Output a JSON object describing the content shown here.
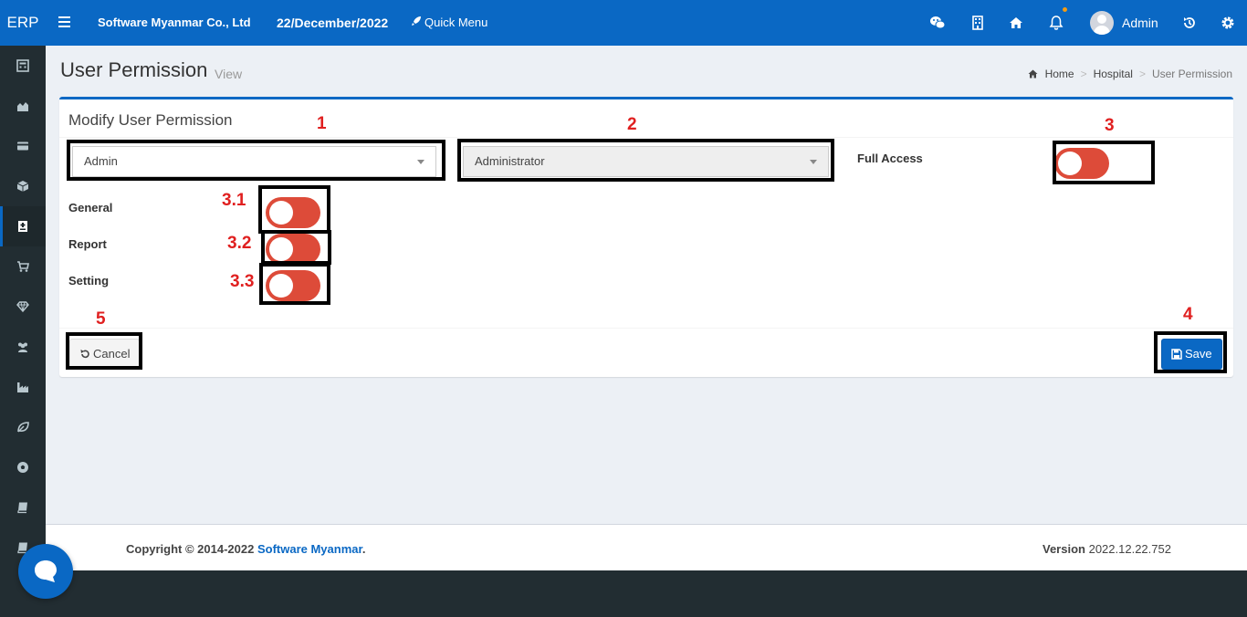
{
  "topbar": {
    "logo": "ERP",
    "company": "Software Myanmar Co., Ltd",
    "date": "22/December/2022",
    "quick_menu": "Quick Menu",
    "username": "Admin"
  },
  "sidebar": {
    "icons": [
      "calculator-icon",
      "area-chart-icon",
      "credit-card-icon",
      "cube-icon",
      "hospital-icon",
      "cart-icon",
      "diamond-icon",
      "users-icon",
      "industry-icon",
      "leaf-icon",
      "soccer-icon",
      "book-icon",
      "book-icon",
      "comment-icon"
    ],
    "active_index": 4
  },
  "header": {
    "title": "User Permission",
    "subtitle": "View",
    "breadcrumb": [
      "Home",
      "Hospital",
      "User Permission"
    ]
  },
  "box": {
    "title": "Modify User Permission",
    "user_select": "Admin",
    "role_select": "Administrator",
    "full_access_label": "Full Access",
    "permissions": [
      {
        "label": "General"
      },
      {
        "label": "Report"
      },
      {
        "label": "Setting"
      }
    ],
    "cancel_label": "Cancel",
    "save_label": "Save"
  },
  "annotations": [
    "1",
    "2",
    "3",
    "3.1",
    "3.2",
    "3.3",
    "4",
    "5"
  ],
  "footer": {
    "copyright_prefix": "Copyright © 2014-2022 ",
    "copyright_link": "Software Myanmar",
    "copyright_suffix": ".",
    "version_label": "Version",
    "version_value": "2022.12.22.752"
  },
  "colors": {
    "primary": "#0a68c4",
    "toggle_off": "#dd4b39",
    "sidebar": "#222d32",
    "annotation": "#e02020"
  }
}
